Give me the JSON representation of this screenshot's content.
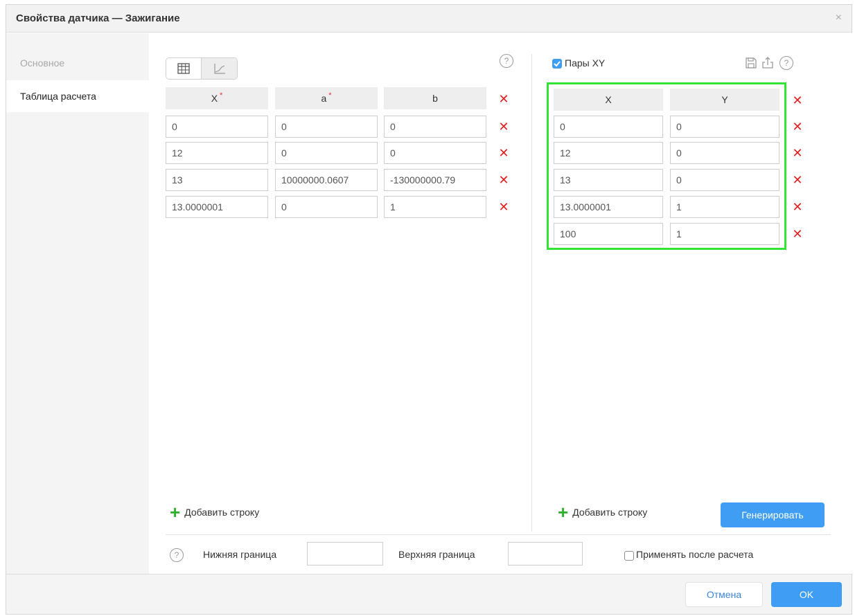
{
  "dialog": {
    "title": "Свойства датчика — Зажигание",
    "close_symbol": "×"
  },
  "sidebar": {
    "items": [
      {
        "label": "Основное",
        "active": false
      },
      {
        "label": "Таблица расчета",
        "active": true
      }
    ]
  },
  "calc_table": {
    "view_modes": [
      {
        "icon": "table-view-icon",
        "selected": true
      },
      {
        "icon": "chart-view-icon",
        "selected": false
      }
    ],
    "help_symbol": "?",
    "headers": [
      {
        "label": "X",
        "required": true
      },
      {
        "label": "a",
        "required": true
      },
      {
        "label": "b",
        "required": false
      }
    ],
    "required_mark": "*",
    "rows": [
      [
        "0",
        "0",
        "0"
      ],
      [
        "12",
        "0",
        "0"
      ],
      [
        "13",
        "10000000.0607",
        "-130000000.79"
      ],
      [
        "13.0000001",
        "0",
        "1"
      ]
    ],
    "delete_symbol": "✕",
    "add_row_label": "Добавить строку",
    "plus_symbol": "+"
  },
  "xy_pairs": {
    "enabled": true,
    "label": "Пары XY",
    "toolbar_icons": [
      "save-icon",
      "export-icon",
      "help-icon"
    ],
    "headers": [
      "X",
      "Y"
    ],
    "rows": [
      [
        "0",
        "0"
      ],
      [
        "12",
        "0"
      ],
      [
        "13",
        "0"
      ],
      [
        "13.0000001",
        "1"
      ],
      [
        "100",
        "1"
      ]
    ],
    "add_row_label": "Добавить строку",
    "generate_label": "Генерировать",
    "highlight_color": "#33e533"
  },
  "bounds": {
    "lower_label": "Нижняя граница",
    "lower_value": "",
    "upper_label": "Верхняя граница",
    "upper_value": "",
    "apply_after_calc_label": "Применять после расчета",
    "apply_after_calc_checked": false
  },
  "footer": {
    "cancel_label": "Отмена",
    "ok_label": "OK"
  },
  "colors": {
    "accent": "#3f9df3",
    "delete": "#e02020",
    "add": "#2fb12f"
  }
}
